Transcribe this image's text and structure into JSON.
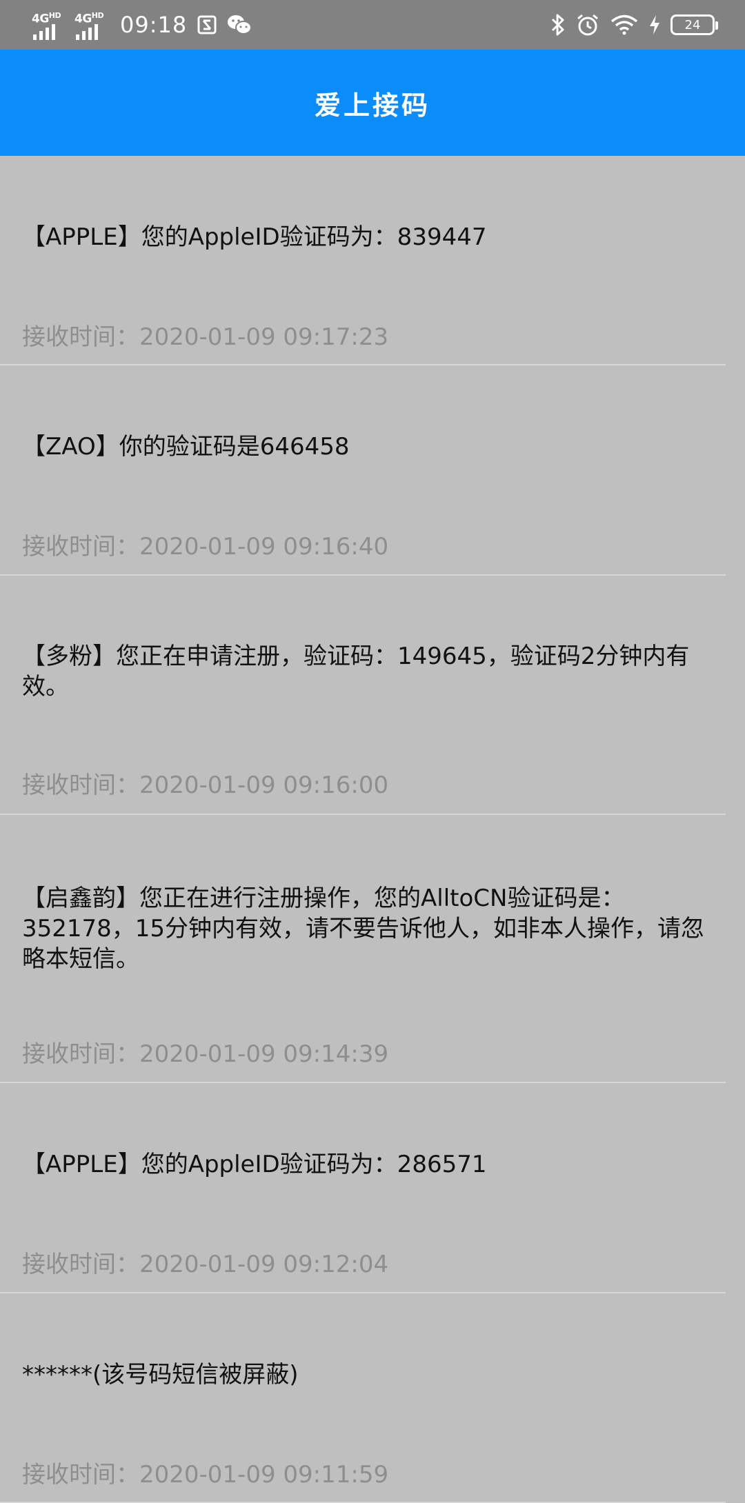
{
  "status_bar": {
    "net1": "4G",
    "net1_sup": "HD",
    "net2": "4G",
    "net2_sup": "HD",
    "time": "09:18",
    "battery": "24"
  },
  "header": {
    "title": "爱上接码"
  },
  "messages": [
    {
      "text": "【APPLE】您的AppleID验证码为：839447",
      "time_label": "接收时间：",
      "time": "2020-01-09 09:17:23"
    },
    {
      "text": "【ZAO】你的验证码是646458",
      "time_label": "接收时间：",
      "time": "2020-01-09 09:16:40"
    },
    {
      "text": "【多粉】您正在申请注册，验证码：149645，验证码2分钟内有效。",
      "time_label": "接收时间：",
      "time": "2020-01-09 09:16:00"
    },
    {
      "text": "【启鑫韵】您正在进行注册操作，您的AlltoCN验证码是：352178，15分钟内有效，请不要告诉他人，如非本人操作，请忽略本短信。",
      "time_label": "接收时间：",
      "time": "2020-01-09 09:14:39"
    },
    {
      "text": "【APPLE】您的AppleID验证码为：286571",
      "time_label": "接收时间：",
      "time": "2020-01-09 09:12:04"
    },
    {
      "text": "******(该号码短信被屏蔽)",
      "time_label": "接收时间：",
      "time": "2020-01-09 09:11:59"
    }
  ]
}
